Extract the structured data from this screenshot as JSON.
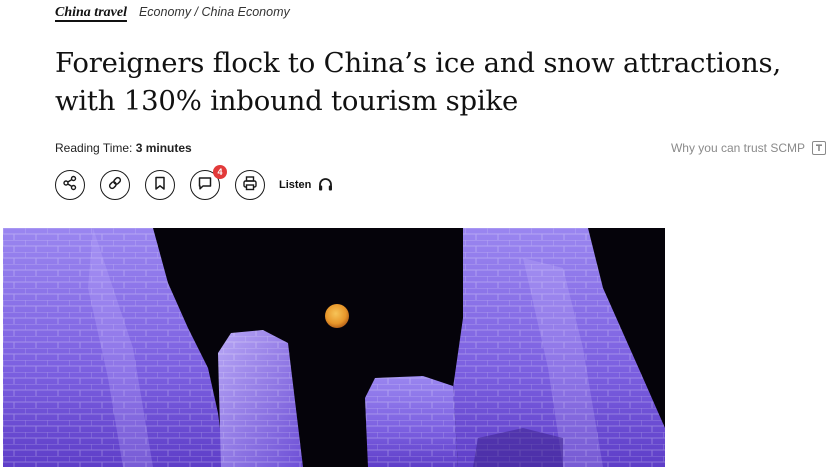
{
  "breadcrumb": {
    "primary": "China travel",
    "secondary": "Economy / China Economy"
  },
  "article": {
    "headline": "Foreigners flock to China’s ice and snow attractions, with 130% inbound tourism spike",
    "reading_time_label": "Reading Time:",
    "reading_time_value": "3 minutes",
    "trust_link": "Why you can trust SCMP"
  },
  "toolbar": {
    "buttons": [
      {
        "name": "share",
        "icon": "share-icon"
      },
      {
        "name": "copy-link",
        "icon": "link-icon"
      },
      {
        "name": "bookmark",
        "icon": "bookmark-icon"
      },
      {
        "name": "comments",
        "icon": "comment-icon",
        "count": "4"
      },
      {
        "name": "print",
        "icon": "printer-icon"
      }
    ],
    "listen_label": "Listen",
    "listen_icon": "headphones-icon"
  },
  "hero_image": {
    "subject": "Illuminated ice sculptures under a full moon",
    "colors": {
      "ice": "#7b5fe0",
      "sky": "#05030a",
      "moon": "#f0a030"
    }
  },
  "colors": {
    "badge": "#e23a3a",
    "muted": "#8a8a8a"
  }
}
